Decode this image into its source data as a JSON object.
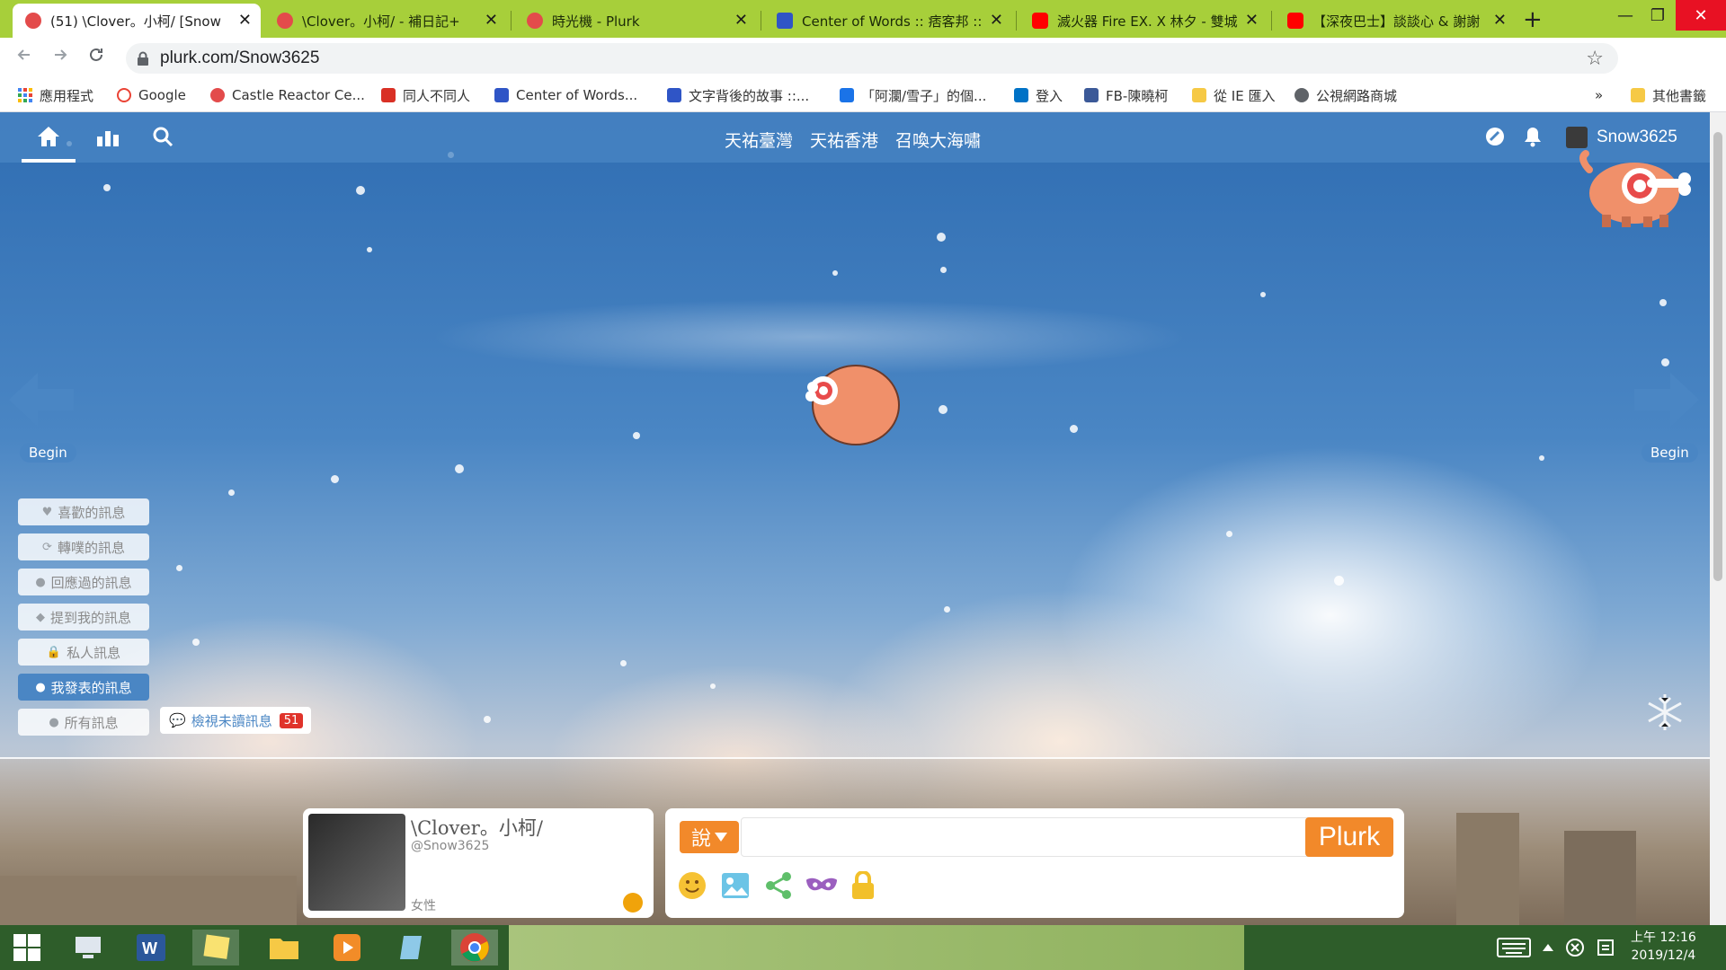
{
  "browser": {
    "tabs": [
      {
        "title": "(51) \\Clover。小柯/ [Snow",
        "favicon_color": "#e34b4b",
        "active": true
      },
      {
        "title": "\\Clover。小柯/ - 補日記+",
        "favicon_color": "#e34b4b",
        "active": false
      },
      {
        "title": "時光機 - Plurk",
        "favicon_color": "#e34b4b",
        "active": false
      },
      {
        "title": "Center of Words :: 痞客邦 ::",
        "favicon_color": "#2f55c6",
        "active": false
      },
      {
        "title": "滅火器 Fire EX. X 林夕 - 雙城",
        "favicon_color": "#ff0000",
        "active": false
      },
      {
        "title": "【深夜巴士】談談心 & 謝謝",
        "favicon_color": "#ff0000",
        "active": false
      }
    ],
    "close_glyph": "✕",
    "new_tab_glyph": "+",
    "window_controls": {
      "minimize": "—",
      "maximize": "❐",
      "close": "✕"
    },
    "url": "plurk.com/Snow3625",
    "bookmarks": [
      {
        "label": "應用程式",
        "color": "#4285f4"
      },
      {
        "label": "Google",
        "color": "#ea4335"
      },
      {
        "label": "Castle Reactor Ce...",
        "color": "#e34b4b"
      },
      {
        "label": "同人不同人",
        "color": "#d93025"
      },
      {
        "label": "Center of Words...",
        "color": "#2f55c6"
      },
      {
        "label": "文字背後的故事 ::...",
        "color": "#2f55c6"
      },
      {
        "label": "「阿瀾/雪子」的個...",
        "color": "#1a73e8"
      },
      {
        "label": "登入",
        "color": "#0072c6"
      },
      {
        "label": "FB-陳曉柯",
        "color": "#3b5998"
      },
      {
        "label": "從 IE 匯入",
        "color": "#f6c945"
      },
      {
        "label": "公視網路商城",
        "color": "#5f6368"
      }
    ],
    "bookmarks_more": "»",
    "other_bookmarks": "其他書籤"
  },
  "site": {
    "channels": [
      "天祐臺灣",
      "天祐香港",
      "召喚大海嘯"
    ],
    "username": "Snow3625",
    "begin_label": "Begin",
    "filters": [
      {
        "label": "喜歡的訊息",
        "icon": "♥",
        "selected": false
      },
      {
        "label": "轉噗的訊息",
        "icon": "⟳",
        "selected": false
      },
      {
        "label": "回應過的訊息",
        "icon": "●",
        "selected": false
      },
      {
        "label": "提到我的訊息",
        "icon": "◆",
        "selected": false
      },
      {
        "label": "私人訊息",
        "icon": "🔒",
        "selected": false
      },
      {
        "label": "我發表的訊息",
        "icon": "●",
        "selected": true
      },
      {
        "label": "所有訊息",
        "icon": "●",
        "selected": false
      }
    ],
    "unread": {
      "label": "檢視未讀訊息",
      "count": "51"
    },
    "profile": {
      "name": "\\Clover。小柯/",
      "handle": "@Snow3625",
      "gender": "女性"
    },
    "compose": {
      "qualifier": "說",
      "placeholder": "",
      "submit": "Plurk"
    }
  },
  "taskbar": {
    "time": "上午 12:16",
    "date": "2019/12/4"
  },
  "colors": {
    "tab_strip": "#a7cf3a",
    "site_bar": "#4a86c4",
    "accent_orange": "#f2892a",
    "unread_badge": "#e0332b"
  }
}
